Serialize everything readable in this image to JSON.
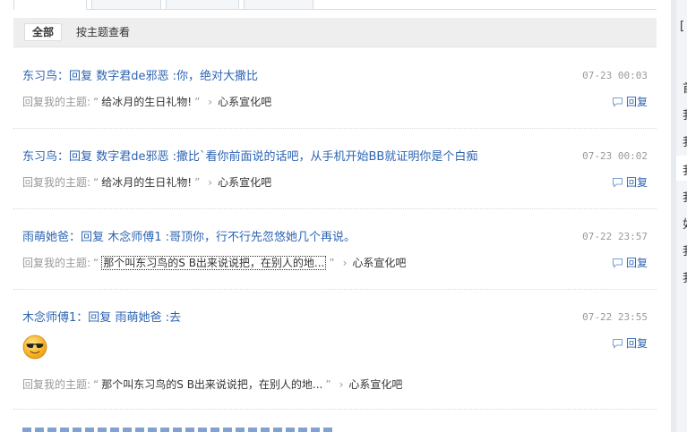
{
  "filter": {
    "all_label": "全部",
    "by_topic_label": "按主题查看"
  },
  "source_prefix": "回复我的主题:",
  "reply_label": "回复",
  "items": [
    {
      "user": "东习鸟",
      "reply_word": "回复",
      "target": "数字君de邪恶",
      "content": "你，绝对大撒比",
      "time": "07-23 00:03",
      "topic": "给冰月的生日礼物!",
      "forum": "心系宣化吧"
    },
    {
      "user": "东习鸟",
      "reply_word": "回复",
      "target": "数字君de邪恶",
      "content": "撒比`看你前面说的话吧，从手机开始BB就证明你是个白痴",
      "time": "07-23 00:02",
      "topic": "给冰月的生日礼物!",
      "forum": "心系宣化吧"
    },
    {
      "user": "雨萌她爸",
      "reply_word": "回复",
      "target": "木念师傅1",
      "content": "哥顶你，行不行先忽悠她几个再说。",
      "time": "07-22 23:57",
      "topic": "那个叫东习鸟的S B出来说说把，在别人的地...",
      "forum": "心系宣化吧"
    },
    {
      "user": "木念师傅1",
      "reply_word": "回复",
      "target": "雨萌她爸",
      "content": "去",
      "time": "07-22 23:55",
      "topic": "那个叫东习鸟的S B出来说说把，在别人的地...",
      "forum": "心系宣化吧",
      "emoji": "sunglasses-smiley"
    }
  ],
  "sidebar_chars": [
    "[",
    "首",
    "我",
    "我",
    "我",
    "我",
    "如",
    "我",
    "我"
  ]
}
